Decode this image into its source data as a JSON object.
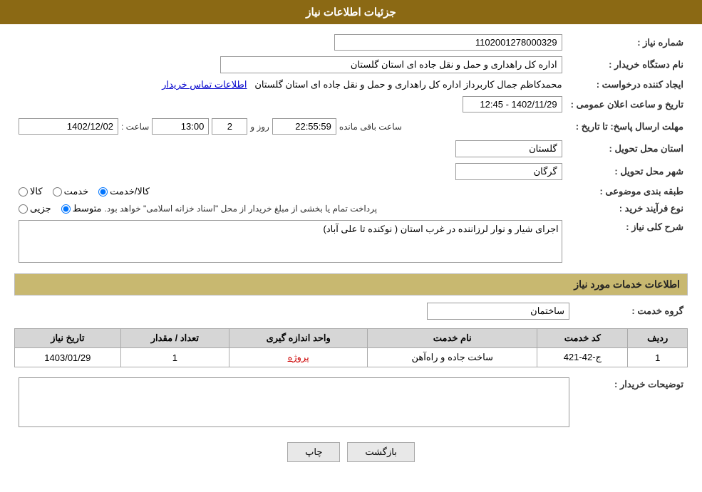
{
  "header": {
    "title": "جزئیات اطلاعات نیاز"
  },
  "fields": {
    "need_number_label": "شماره نیاز :",
    "need_number_value": "1102001278000329",
    "buyer_org_label": "نام دستگاه خریدار :",
    "buyer_org_value": "اداره کل راهداری و حمل و نقل جاده ای استان گلستان",
    "requester_label": "ایجاد کننده درخواست :",
    "requester_value": "محمدکاظم جمال کاربرداز اداره کل راهداری و حمل و نقل جاده ای استان گلستان",
    "requester_link": "اطلاعات تماس خریدار",
    "announce_datetime_label": "تاریخ و ساعت اعلان عمومی :",
    "announce_datetime_value": "1402/11/29 - 12:45",
    "deadline_label": "مهلت ارسال پاسخ: تا تاریخ :",
    "deadline_date": "1402/12/02",
    "deadline_time_label": "ساعت :",
    "deadline_time": "13:00",
    "deadline_days_label": "روز و",
    "deadline_days": "2",
    "deadline_countdown_label": "ساعت باقی مانده",
    "deadline_countdown": "22:55:59",
    "delivery_province_label": "استان محل تحویل :",
    "delivery_province_value": "گلستان",
    "delivery_city_label": "شهر محل تحویل :",
    "delivery_city_value": "گرگان",
    "category_label": "طبقه بندی موضوعی :",
    "category_options": [
      {
        "label": "کالا",
        "value": "kala",
        "checked": false
      },
      {
        "label": "خدمت",
        "value": "khedmat",
        "checked": false
      },
      {
        "label": "کالا/خدمت",
        "value": "kala_khedmat",
        "checked": true
      }
    ],
    "purchase_type_label": "نوع فرآیند خرید :",
    "purchase_type_options": [
      {
        "label": "جزیی",
        "value": "jozei",
        "checked": false
      },
      {
        "label": "متوسط",
        "value": "motavasset",
        "checked": true
      }
    ],
    "purchase_type_note": "پرداخت تمام یا بخشی از مبلغ خریدار از محل \"اسناد خزانه اسلامی\" خواهد بود.",
    "description_label": "شرح کلی نیاز :",
    "description_value": "اجرای شیار و نوار لرزاننده در غرب استان ( نوکنده تا علی آباد)",
    "services_section_label": "اطلاعات خدمات مورد نیاز",
    "service_group_label": "گروه خدمت :",
    "service_group_value": "ساختمان",
    "services_table": {
      "columns": [
        "ردیف",
        "کد خدمت",
        "نام خدمت",
        "واحد اندازه گیری",
        "تعداد / مقدار",
        "تاریخ نیاز"
      ],
      "rows": [
        {
          "row": "1",
          "code": "ج-42-421",
          "name": "ساخت جاده و راه‌آهن",
          "unit": "پروژه",
          "quantity": "1",
          "date": "1403/01/29"
        }
      ]
    },
    "buyer_desc_label": "توضیحات خریدار :",
    "buyer_desc_value": ""
  },
  "buttons": {
    "print": "چاپ",
    "back": "بازگشت"
  }
}
